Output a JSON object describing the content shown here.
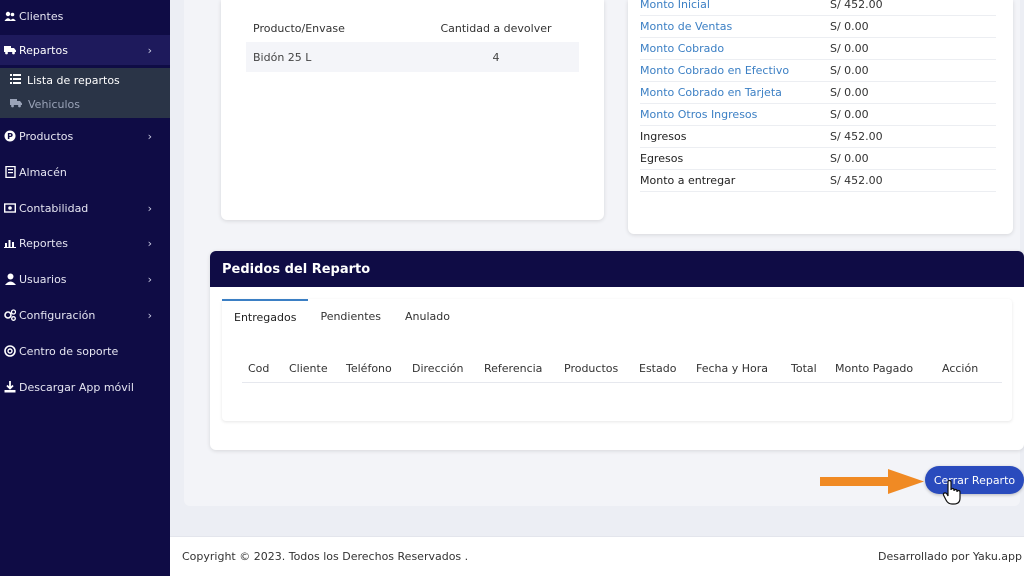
{
  "sidebar": {
    "items": [
      {
        "label": "Clientes",
        "icon": "users-icon"
      },
      {
        "label": "Repartos",
        "icon": "truck-icon",
        "active": true
      },
      {
        "label": "Productos",
        "icon": "product-icon"
      },
      {
        "label": "Almacén",
        "icon": "warehouse-icon"
      },
      {
        "label": "Contabilidad",
        "icon": "money-icon"
      },
      {
        "label": "Reportes",
        "icon": "chart-icon"
      },
      {
        "label": "Usuarios",
        "icon": "user-icon"
      },
      {
        "label": "Configuración",
        "icon": "gears-icon"
      },
      {
        "label": "Centro de soporte",
        "icon": "support-icon"
      },
      {
        "label": "Descargar App móvil",
        "icon": "download-icon"
      }
    ],
    "sub_items": [
      {
        "label": "Lista de repartos",
        "icon": "list-icon"
      },
      {
        "label": "Vehiculos",
        "icon": "truck-icon"
      }
    ]
  },
  "returns": {
    "col_product": "Producto/Envase",
    "col_qty": "Cantidad a devolver",
    "rows": [
      {
        "product": "Bidón 25 L",
        "qty": "4"
      }
    ]
  },
  "summary": {
    "rows": [
      {
        "label": "Monto Inicial",
        "value": "S/ 452.00",
        "link": true
      },
      {
        "label": "Monto de Ventas",
        "value": "S/ 0.00",
        "link": true
      },
      {
        "label": "Monto Cobrado",
        "value": "S/ 0.00",
        "link": true
      },
      {
        "label": "Monto Cobrado en Efectivo",
        "value": "S/ 0.00",
        "link": true
      },
      {
        "label": "Monto Cobrado en Tarjeta",
        "value": "S/ 0.00",
        "link": true
      },
      {
        "label": "Monto Otros Ingresos",
        "value": "S/ 0.00",
        "link": true
      },
      {
        "label": "Ingresos",
        "value": "S/ 452.00",
        "link": false
      },
      {
        "label": "Egresos",
        "value": "S/ 0.00",
        "link": false
      },
      {
        "label": "Monto a entregar",
        "value": "S/ 452.00",
        "link": false
      }
    ]
  },
  "orders": {
    "title": "Pedidos del Reparto",
    "tabs": [
      "Entregados",
      "Pendientes",
      "Anulado"
    ],
    "columns": [
      "Cod",
      "Cliente",
      "Teléfono",
      "Dirección",
      "Referencia",
      "Productos",
      "Estado",
      "Fecha y Hora",
      "Total",
      "Monto Pagado",
      "Acción"
    ]
  },
  "close_button": "Cerrar Reparto",
  "footer": {
    "copyright": "Copyright © 2023. Todos los Derechos Reservados .",
    "developed": "Desarrollado por Yaku.app"
  },
  "colors": {
    "sidebar_bg": "#0f0c45",
    "link": "#3b7fc4",
    "button": "#2a4bbd",
    "arrow": "#f08a24"
  }
}
